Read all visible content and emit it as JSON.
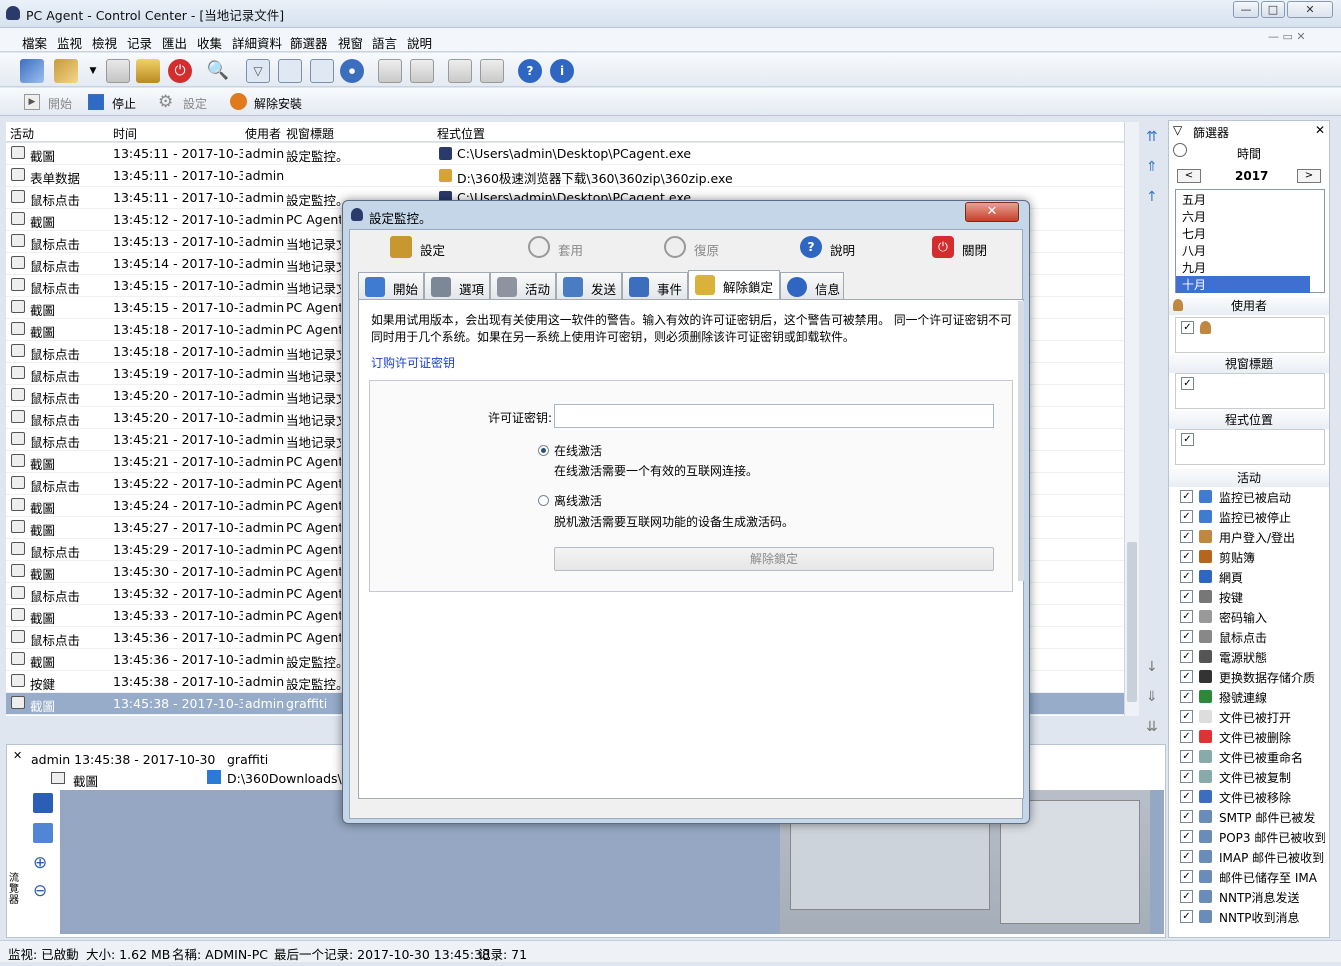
{
  "window": {
    "title": "PC Agent - Control Center - [当地记录文件]",
    "minimize": "—",
    "maximize": "□",
    "close": "✕"
  },
  "menu": [
    "檔案",
    "监视",
    "檢視",
    "记录",
    "匯出",
    "收集",
    "詳細資料",
    "篩選器",
    "視窗",
    "語言",
    "說明"
  ],
  "toolbar2": {
    "start": "開始",
    "stop": "停止",
    "settings": "設定",
    "uninstall": "解除安裝"
  },
  "columns": [
    "活动",
    "时间",
    "使用者",
    "视窗標題",
    "程式位置"
  ],
  "rows": [
    {
      "activity": "截圖",
      "time": "13:45:11 - 2017-10-30",
      "user": "admin",
      "title": "設定監控。",
      "path": "C:\\Users\\admin\\Desktop\\PCagent.exe"
    },
    {
      "activity": "表单数据",
      "time": "13:45:11 - 2017-10-30",
      "user": "admin",
      "title": "",
      "path": "D:\\360极速浏览器下载\\360\\360zip\\360zip.exe"
    },
    {
      "activity": "鼠标点击",
      "time": "13:45:11 - 2017-10-30",
      "user": "admin",
      "title": "設定監控。",
      "path": "C:\\Users\\admin\\Desktop\\PCagent.exe"
    },
    {
      "activity": "截圖",
      "time": "13:45:12 - 2017-10-30",
      "user": "admin",
      "title": "PC Agent",
      "path": ""
    },
    {
      "activity": "鼠标点击",
      "time": "13:45:13 - 2017-10-30",
      "user": "admin",
      "title": "当地记录文",
      "path": ""
    },
    {
      "activity": "鼠标点击",
      "time": "13:45:14 - 2017-10-30",
      "user": "admin",
      "title": "当地记录文",
      "path": ""
    },
    {
      "activity": "鼠标点击",
      "time": "13:45:15 - 2017-10-30",
      "user": "admin",
      "title": "当地记录文",
      "path": ""
    },
    {
      "activity": "截圖",
      "time": "13:45:15 - 2017-10-30",
      "user": "admin",
      "title": "PC Agent",
      "path": ""
    },
    {
      "activity": "截圖",
      "time": "13:45:18 - 2017-10-30",
      "user": "admin",
      "title": "PC Agent",
      "path": ""
    },
    {
      "activity": "鼠标点击",
      "time": "13:45:18 - 2017-10-30",
      "user": "admin",
      "title": "当地记录文",
      "path": ""
    },
    {
      "activity": "鼠标点击",
      "time": "13:45:19 - 2017-10-30",
      "user": "admin",
      "title": "当地记录文",
      "path": ""
    },
    {
      "activity": "鼠标点击",
      "time": "13:45:20 - 2017-10-30",
      "user": "admin",
      "title": "当地记录文",
      "path": ""
    },
    {
      "activity": "鼠标点击",
      "time": "13:45:20 - 2017-10-30",
      "user": "admin",
      "title": "当地记录文",
      "path": ""
    },
    {
      "activity": "鼠标点击",
      "time": "13:45:21 - 2017-10-30",
      "user": "admin",
      "title": "当地记录文",
      "path": ""
    },
    {
      "activity": "截圖",
      "time": "13:45:21 - 2017-10-30",
      "user": "admin",
      "title": "PC Agent",
      "path": ""
    },
    {
      "activity": "鼠标点击",
      "time": "13:45:22 - 2017-10-30",
      "user": "admin",
      "title": "PC Agent",
      "path": ""
    },
    {
      "activity": "截圖",
      "time": "13:45:24 - 2017-10-30",
      "user": "admin",
      "title": "PC Agent",
      "path": ""
    },
    {
      "activity": "截圖",
      "time": "13:45:27 - 2017-10-30",
      "user": "admin",
      "title": "PC Agent",
      "path": ""
    },
    {
      "activity": "鼠标点击",
      "time": "13:45:29 - 2017-10-30",
      "user": "admin",
      "title": "PC Agent",
      "path": ""
    },
    {
      "activity": "截圖",
      "time": "13:45:30 - 2017-10-30",
      "user": "admin",
      "title": "PC Agent",
      "path": ""
    },
    {
      "activity": "鼠标点击",
      "time": "13:45:32 - 2017-10-30",
      "user": "admin",
      "title": "PC Agent",
      "path": ""
    },
    {
      "activity": "截圖",
      "time": "13:45:33 - 2017-10-30",
      "user": "admin",
      "title": "PC Agent",
      "path": ""
    },
    {
      "activity": "鼠标点击",
      "time": "13:45:36 - 2017-10-30",
      "user": "admin",
      "title": "PC Agent",
      "path": ""
    },
    {
      "activity": "截圖",
      "time": "13:45:36 - 2017-10-30",
      "user": "admin",
      "title": "設定監控。",
      "path": ""
    },
    {
      "activity": "按鍵",
      "time": "13:45:38 - 2017-10-30",
      "user": "admin",
      "title": "設定監控。",
      "path": ""
    },
    {
      "activity": "截圖",
      "time": "13:45:38 - 2017-10-30",
      "user": "admin",
      "title": "graffiti",
      "path": ""
    }
  ],
  "detail": {
    "header": "admin 13:45:38 - 2017-10-30",
    "title": "graffiti",
    "activity": "截圖",
    "path": "D:\\360Downloads\\D",
    "side_label": "流覽器"
  },
  "filter": {
    "title": "篩選器",
    "time": "時間",
    "year": "2017",
    "prev": "<",
    "next": ">",
    "months": [
      "五月",
      "六月",
      "七月",
      "八月",
      "九月",
      "十月"
    ],
    "user": "使用者",
    "window_title": "視窗標題",
    "program": "程式位置",
    "activity": "活动",
    "activities": [
      "监控已被启动",
      "监控已被停止",
      "用户登入/登出",
      "剪贴簿",
      "網頁",
      "按键",
      "密码输入",
      "鼠标点击",
      "電源狀態",
      "更换数据存储介质",
      "撥號連線",
      "文件已被打开",
      "文件已被删除",
      "文件已被重命名",
      "文件已被复制",
      "文件已被移除",
      "SMTP 邮件已被发",
      "POP3 邮件已被收到",
      "IMAP 邮件已被收到",
      "邮件已储存至 IMA",
      "NNTP消息发送",
      "NNTP收到消息"
    ]
  },
  "status": {
    "monitor": "监视: 已啟動",
    "size": "大小: 1.62 MB",
    "name": "名稱: ADMIN-PC",
    "last": "最后一个记录: 2017-10-30 13:45:38",
    "count": "记录: 71"
  },
  "dialog": {
    "title": "設定監控。",
    "close": "✕",
    "toolbar": {
      "settings": "設定",
      "apply": "套用",
      "restore": "復原",
      "help": "說明",
      "close": "關閉"
    },
    "tabs": [
      "開始",
      "選項",
      "活动",
      "发送",
      "事件",
      "解除鎖定",
      "信息"
    ],
    "warning": "如果用试用版本，会出现有关使用这一软件的警告。输入有效的许可证密钥后，这个警告可被禁用。 同一个许可证密钥不可同时用于几个系统。如果在另一系统上使用许可密钥，则必须删除该许可证密钥或卸载软件。",
    "buy_link": "订购许可证密钥",
    "key_label": "许可证密钥:",
    "key_value": "",
    "online": "在线激活",
    "online_desc": "在线激活需要一个有效的互联网连接。",
    "offline": "离线激活",
    "offline_desc": "脱机激活需要互联网功能的设备生成激活码。",
    "unlock": "解除鎖定"
  }
}
